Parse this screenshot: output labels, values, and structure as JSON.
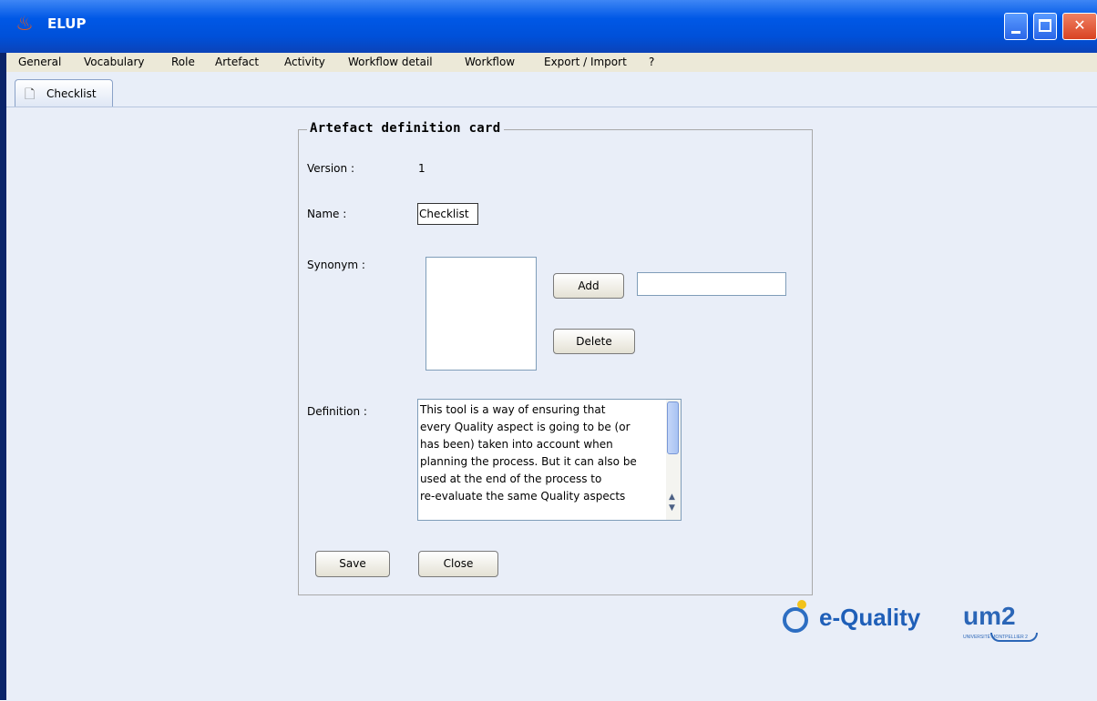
{
  "window": {
    "title": "ELUP",
    "controls": {
      "minimize": "minimize",
      "maximize": "maximize",
      "close": "close"
    }
  },
  "menu": {
    "items": [
      "General",
      "Vocabulary",
      "Role",
      "Artefact",
      "Activity",
      "Workflow detail",
      "Workflow",
      "Export / Import",
      "?"
    ]
  },
  "tabs": [
    {
      "label": "Checklist",
      "icon": "document-icon",
      "active": true
    }
  ],
  "card": {
    "title": "Artefact definition card",
    "version_label": "Version :",
    "version_value": "1",
    "name_label": "Name :",
    "name_value": "Checklist",
    "synonym_label": "Synonym :",
    "synonyms": [],
    "synonym_input_value": "",
    "add_label": "Add",
    "delete_label": "Delete",
    "definition_label": "Definition :",
    "definition_text": "This tool is a way of ensuring that\nevery Quality aspect is going to be (or\nhas been) taken into account when\nplanning the process. But it can also be\nused at the end of the process to\nre-evaluate the same Quality aspects",
    "save_label": "Save",
    "close_label": "Close"
  },
  "logos": {
    "equality": "e-Quality",
    "um2": "um2",
    "um2_subtitle": "UNIVERSITÉ MONTPELLIER 2"
  },
  "colors": {
    "titlebar": "#0058e6",
    "menubar": "#ece9d8",
    "content_bg": "#e9eef8",
    "logo_blue": "#2b66b7",
    "logo_yellow": "#f2c21a"
  }
}
